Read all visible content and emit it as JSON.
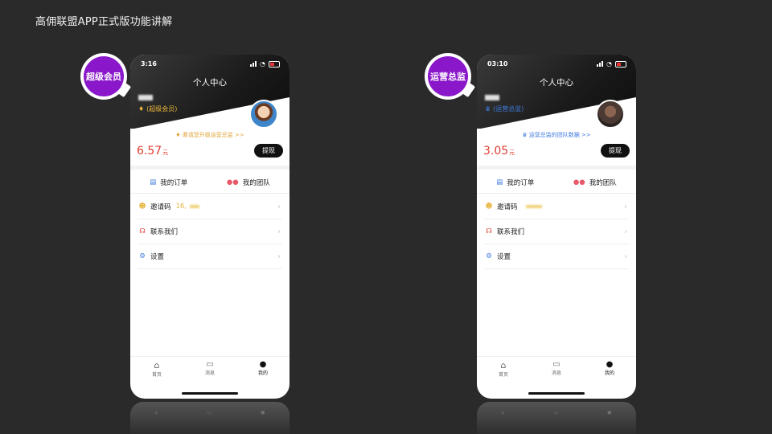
{
  "slide_title": "高佣联盟APP正式版功能讲解",
  "phones": [
    {
      "badge": "超级会员",
      "time": "3:16",
      "page_title": "个人中心",
      "role": "(超级会员)",
      "promo": "邀请您升级运营总监 >>",
      "amount": "6.57",
      "amount_unit": "元",
      "withdraw": "提现",
      "orders": "我的订单",
      "team": "我的团队",
      "invite_label": "邀请码",
      "invite_value": "16,",
      "contact": "联系我们",
      "settings": "设置",
      "nav": [
        "首页",
        "消息",
        "我的"
      ],
      "colors": {
        "role": "#e6b33b",
        "badge": "#8a17c9"
      }
    },
    {
      "badge": "运营总监",
      "time": "03:10",
      "page_title": "个人中心",
      "role": "(运营总监)",
      "promo": "运营总监的团队数据 >>",
      "amount": "3.05",
      "amount_unit": "元",
      "withdraw": "提现",
      "orders": "我的订单",
      "team": "我的团队",
      "invite_label": "邀请码",
      "invite_value": "",
      "contact": "联系我们",
      "settings": "设置",
      "nav": [
        "首页",
        "消息",
        "我的"
      ],
      "colors": {
        "role": "#3f7be0",
        "badge": "#8a17c9"
      }
    }
  ]
}
